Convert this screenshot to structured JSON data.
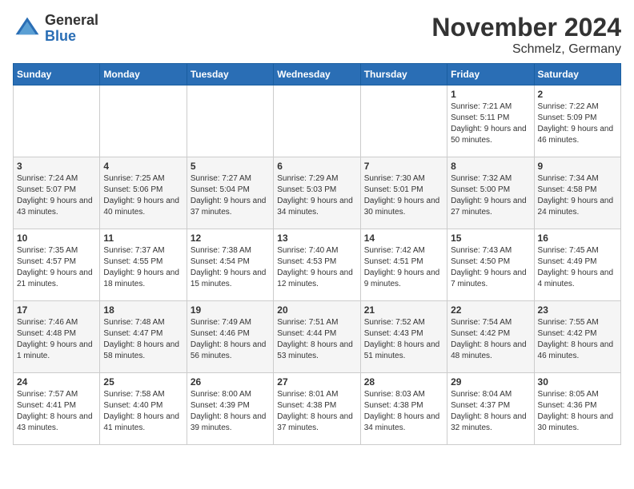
{
  "header": {
    "logo_general": "General",
    "logo_blue": "Blue",
    "title": "November 2024",
    "subtitle": "Schmelz, Germany"
  },
  "weekdays": [
    "Sunday",
    "Monday",
    "Tuesday",
    "Wednesday",
    "Thursday",
    "Friday",
    "Saturday"
  ],
  "weeks": [
    [
      {
        "day": "",
        "detail": ""
      },
      {
        "day": "",
        "detail": ""
      },
      {
        "day": "",
        "detail": ""
      },
      {
        "day": "",
        "detail": ""
      },
      {
        "day": "",
        "detail": ""
      },
      {
        "day": "1",
        "detail": "Sunrise: 7:21 AM\nSunset: 5:11 PM\nDaylight: 9 hours and 50 minutes."
      },
      {
        "day": "2",
        "detail": "Sunrise: 7:22 AM\nSunset: 5:09 PM\nDaylight: 9 hours and 46 minutes."
      }
    ],
    [
      {
        "day": "3",
        "detail": "Sunrise: 7:24 AM\nSunset: 5:07 PM\nDaylight: 9 hours and 43 minutes."
      },
      {
        "day": "4",
        "detail": "Sunrise: 7:25 AM\nSunset: 5:06 PM\nDaylight: 9 hours and 40 minutes."
      },
      {
        "day": "5",
        "detail": "Sunrise: 7:27 AM\nSunset: 5:04 PM\nDaylight: 9 hours and 37 minutes."
      },
      {
        "day": "6",
        "detail": "Sunrise: 7:29 AM\nSunset: 5:03 PM\nDaylight: 9 hours and 34 minutes."
      },
      {
        "day": "7",
        "detail": "Sunrise: 7:30 AM\nSunset: 5:01 PM\nDaylight: 9 hours and 30 minutes."
      },
      {
        "day": "8",
        "detail": "Sunrise: 7:32 AM\nSunset: 5:00 PM\nDaylight: 9 hours and 27 minutes."
      },
      {
        "day": "9",
        "detail": "Sunrise: 7:34 AM\nSunset: 4:58 PM\nDaylight: 9 hours and 24 minutes."
      }
    ],
    [
      {
        "day": "10",
        "detail": "Sunrise: 7:35 AM\nSunset: 4:57 PM\nDaylight: 9 hours and 21 minutes."
      },
      {
        "day": "11",
        "detail": "Sunrise: 7:37 AM\nSunset: 4:55 PM\nDaylight: 9 hours and 18 minutes."
      },
      {
        "day": "12",
        "detail": "Sunrise: 7:38 AM\nSunset: 4:54 PM\nDaylight: 9 hours and 15 minutes."
      },
      {
        "day": "13",
        "detail": "Sunrise: 7:40 AM\nSunset: 4:53 PM\nDaylight: 9 hours and 12 minutes."
      },
      {
        "day": "14",
        "detail": "Sunrise: 7:42 AM\nSunset: 4:51 PM\nDaylight: 9 hours and 9 minutes."
      },
      {
        "day": "15",
        "detail": "Sunrise: 7:43 AM\nSunset: 4:50 PM\nDaylight: 9 hours and 7 minutes."
      },
      {
        "day": "16",
        "detail": "Sunrise: 7:45 AM\nSunset: 4:49 PM\nDaylight: 9 hours and 4 minutes."
      }
    ],
    [
      {
        "day": "17",
        "detail": "Sunrise: 7:46 AM\nSunset: 4:48 PM\nDaylight: 9 hours and 1 minute."
      },
      {
        "day": "18",
        "detail": "Sunrise: 7:48 AM\nSunset: 4:47 PM\nDaylight: 8 hours and 58 minutes."
      },
      {
        "day": "19",
        "detail": "Sunrise: 7:49 AM\nSunset: 4:46 PM\nDaylight: 8 hours and 56 minutes."
      },
      {
        "day": "20",
        "detail": "Sunrise: 7:51 AM\nSunset: 4:44 PM\nDaylight: 8 hours and 53 minutes."
      },
      {
        "day": "21",
        "detail": "Sunrise: 7:52 AM\nSunset: 4:43 PM\nDaylight: 8 hours and 51 minutes."
      },
      {
        "day": "22",
        "detail": "Sunrise: 7:54 AM\nSunset: 4:42 PM\nDaylight: 8 hours and 48 minutes."
      },
      {
        "day": "23",
        "detail": "Sunrise: 7:55 AM\nSunset: 4:42 PM\nDaylight: 8 hours and 46 minutes."
      }
    ],
    [
      {
        "day": "24",
        "detail": "Sunrise: 7:57 AM\nSunset: 4:41 PM\nDaylight: 8 hours and 43 minutes."
      },
      {
        "day": "25",
        "detail": "Sunrise: 7:58 AM\nSunset: 4:40 PM\nDaylight: 8 hours and 41 minutes."
      },
      {
        "day": "26",
        "detail": "Sunrise: 8:00 AM\nSunset: 4:39 PM\nDaylight: 8 hours and 39 minutes."
      },
      {
        "day": "27",
        "detail": "Sunrise: 8:01 AM\nSunset: 4:38 PM\nDaylight: 8 hours and 37 minutes."
      },
      {
        "day": "28",
        "detail": "Sunrise: 8:03 AM\nSunset: 4:38 PM\nDaylight: 8 hours and 34 minutes."
      },
      {
        "day": "29",
        "detail": "Sunrise: 8:04 AM\nSunset: 4:37 PM\nDaylight: 8 hours and 32 minutes."
      },
      {
        "day": "30",
        "detail": "Sunrise: 8:05 AM\nSunset: 4:36 PM\nDaylight: 8 hours and 30 minutes."
      }
    ]
  ]
}
